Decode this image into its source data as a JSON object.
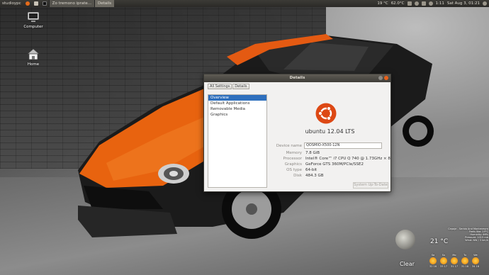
{
  "top_panel": {
    "user": "studioypc",
    "tasks": [
      "Zo tremono iprate...",
      "Details"
    ],
    "weather": "19 °C",
    "cpu_temp": "62.0°C",
    "time_label": "1:11",
    "datetime": "Sat Aug 3, 01:21"
  },
  "desktop": {
    "icons": [
      {
        "label": "Computer"
      },
      {
        "label": "Home"
      }
    ]
  },
  "dialog": {
    "title": "Details",
    "toolbar": {
      "all_settings": "All Settings",
      "details": "Details"
    },
    "sidebar": [
      "Overview",
      "Default Applications",
      "Removable Media",
      "Graphics"
    ],
    "selected_index": 0,
    "os_name": "ubuntu 12.04 LTS",
    "device_name_label": "Device name",
    "device_name": "QOSMIO-X500-12N",
    "rows": [
      {
        "label": "Memory",
        "value": "7.8 GiB"
      },
      {
        "label": "Processor",
        "value": "Intel® Core™ i7 CPU Q 740 @ 1.73GHz × 8"
      },
      {
        "label": "Graphics",
        "value": "GeForce GTS 360M/PCIe/SSE2"
      },
      {
        "label": "OS type",
        "value": "64-bit"
      },
      {
        "label": "Disk",
        "value": "484.3 GB"
      }
    ],
    "update_button": "System Up-To-Date"
  },
  "weather_widget": {
    "condition": "Clear",
    "temperature": "21 °C",
    "station_lines": [
      "Cepoje - Serbia And Montenegro",
      "Feels like: 19°C",
      "Humidity: 66%",
      "Pressure: 1015 mb",
      "Wind: NW / 3 km/h"
    ],
    "forecast": [
      {
        "day": "Sa",
        "temps": "32 16"
      },
      {
        "day": "Su",
        "temps": "33 17"
      },
      {
        "day": "Mo",
        "temps": "31 17"
      },
      {
        "day": "Tu",
        "temps": "31 18"
      },
      {
        "day": "We",
        "temps": "34 18"
      }
    ]
  }
}
